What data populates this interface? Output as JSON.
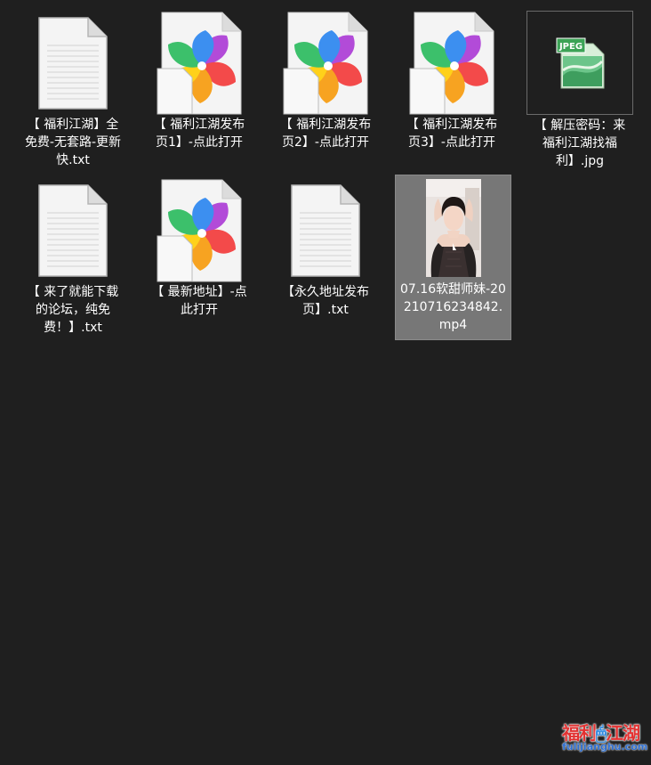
{
  "files": [
    {
      "name": "【 福利江湖】全免费-无套路-更新快.txt",
      "type": "txt"
    },
    {
      "name": "【 福利江湖发布页1】-点此打开",
      "type": "html"
    },
    {
      "name": "【 福利江湖发布页2】-点此打开",
      "type": "html"
    },
    {
      "name": "【 福利江湖发布页3】-点此打开",
      "type": "html"
    },
    {
      "name": "【 解压密码：来福利江湖找福利】.jpg",
      "type": "jpg",
      "icon_text": "JPEG"
    },
    {
      "name": "【 来了就能下载的论坛，纯免费！】.txt",
      "type": "txt"
    },
    {
      "name": "【 最新地址】-点此打开",
      "type": "html"
    },
    {
      "name": "【永久地址发布页】.txt",
      "type": "txt"
    },
    {
      "name": "07.16软甜师妹-20210716234842.mp4",
      "type": "mp4"
    }
  ],
  "watermark": {
    "text_left": "福利",
    "text_right": "江湖",
    "url": "fulijianghu.com"
  },
  "colors": {
    "background": "#1f1f1f",
    "selected": "#777777",
    "text": "#ffffff"
  }
}
